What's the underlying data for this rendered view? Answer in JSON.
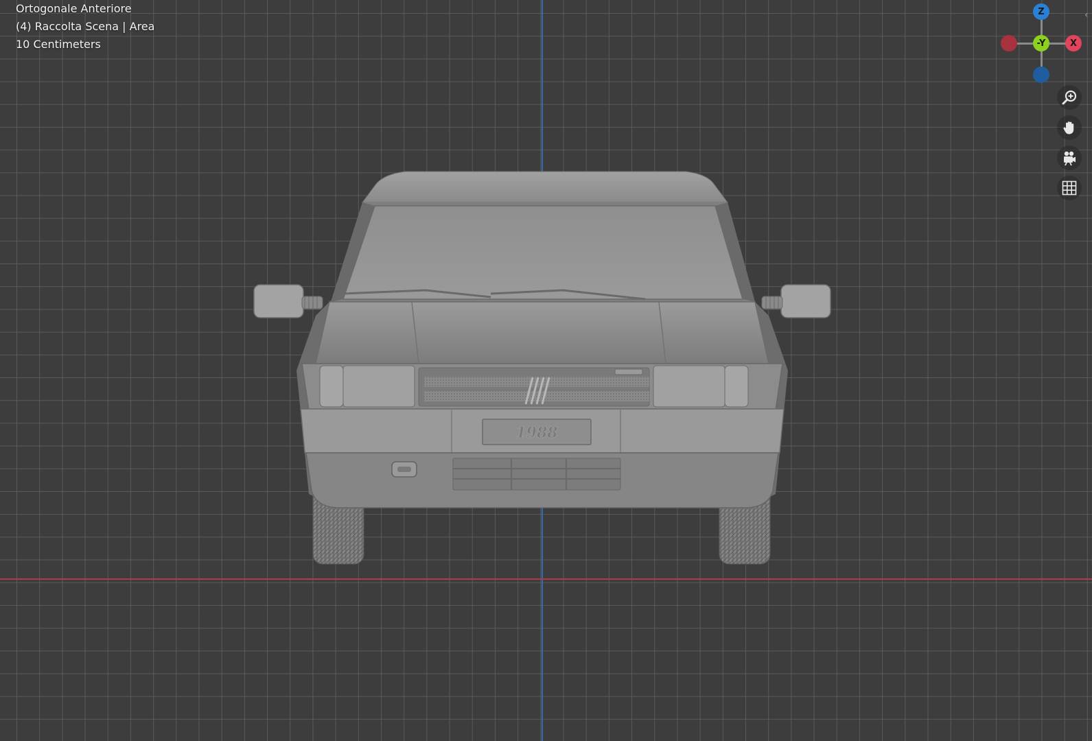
{
  "viewport": {
    "view_name": "Ortogonale Anteriore",
    "collection_info": "(4) Raccolta Scena | Area",
    "grid_scale": "10 Centimeters"
  },
  "gizmo": {
    "z_label": "Z",
    "neg_y_label": "-Y",
    "x_label": "X",
    "colors": {
      "x": "#e2445c",
      "y": "#8bd11e",
      "z": "#2a7fd6",
      "neg_x": "#a8323f",
      "neg_z": "#1f5e9e"
    }
  },
  "nav_tools": [
    "zoom-icon",
    "hand-pan-icon",
    "camera-icon",
    "grid-icon"
  ],
  "car": {
    "license_plate": "1988"
  },
  "colors": {
    "background": "#3d3d3d",
    "grid_line": "#5f5f5f",
    "axis_z": "#2f6db4",
    "axis_x": "#b33a4a",
    "car_body": "#8e8e8e"
  }
}
